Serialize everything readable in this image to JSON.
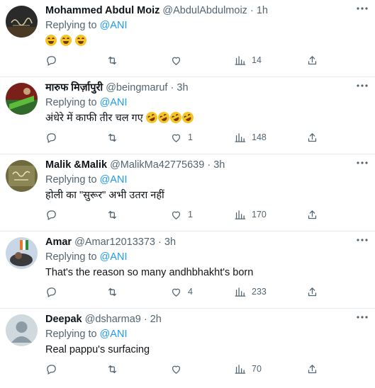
{
  "colors": {
    "link": "#1d9bf0",
    "muted": "#536471",
    "text": "#0f1419",
    "divider": "#e6ecf0"
  },
  "replies": [
    {
      "name": "Mohammed Abdul Moiz",
      "handle": "@AbdulAbdulmoiz",
      "dot": "·",
      "time": "1h",
      "replying_prefix": "Replying to",
      "replying_to": "@ANI",
      "text": "",
      "emoji": [
        "joy-emoji",
        "joy-emoji",
        "joy-emoji"
      ],
      "avatar": "dark-calligraphy-avatar",
      "counts": {
        "replies": "",
        "retweets": "",
        "likes": "",
        "views": "14"
      }
    },
    {
      "name": "मारुफ मिर्ज़ापुरी",
      "handle": "@beingmaruf",
      "dot": "·",
      "time": "3h",
      "replying_prefix": "Replying to",
      "replying_to": "@ANI",
      "text": "अंधेरे में काफी तीर चल गए",
      "emoji": [
        "rofl-emoji",
        "rofl-emoji",
        "rofl-emoji",
        "rofl-emoji"
      ],
      "avatar": "red-green-avatar",
      "counts": {
        "replies": "",
        "retweets": "",
        "likes": "1",
        "views": "148"
      }
    },
    {
      "name": "Malik &Malik",
      "handle": "@MalikMa42775639",
      "dot": "·",
      "time": "3h",
      "replying_prefix": "Replying to",
      "replying_to": "@ANI",
      "text": "होली का \"सुरूर\" अभी उतरा नहीं",
      "emoji": [],
      "avatar": "olive-calligraphy-avatar",
      "counts": {
        "replies": "",
        "retweets": "",
        "likes": "1",
        "views": "170"
      }
    },
    {
      "name": "Amar",
      "handle": "@Amar12013373",
      "dot": "·",
      "time": "3h",
      "replying_prefix": "Replying to",
      "replying_to": "@ANI",
      "text": "That's the reason so many andhbhakht's born",
      "emoji": [],
      "avatar": "flag-avatar",
      "counts": {
        "replies": "",
        "retweets": "",
        "likes": "4",
        "views": "233"
      }
    },
    {
      "name": "Deepak",
      "handle": "@dsharma9",
      "dot": "·",
      "time": "2h",
      "replying_prefix": "Replying to",
      "replying_to": "@ANI",
      "text": "Real pappu's surfacing",
      "emoji": [],
      "avatar": "default-person-avatar",
      "counts": {
        "replies": "",
        "retweets": "",
        "likes": "",
        "views": "70"
      }
    }
  ]
}
